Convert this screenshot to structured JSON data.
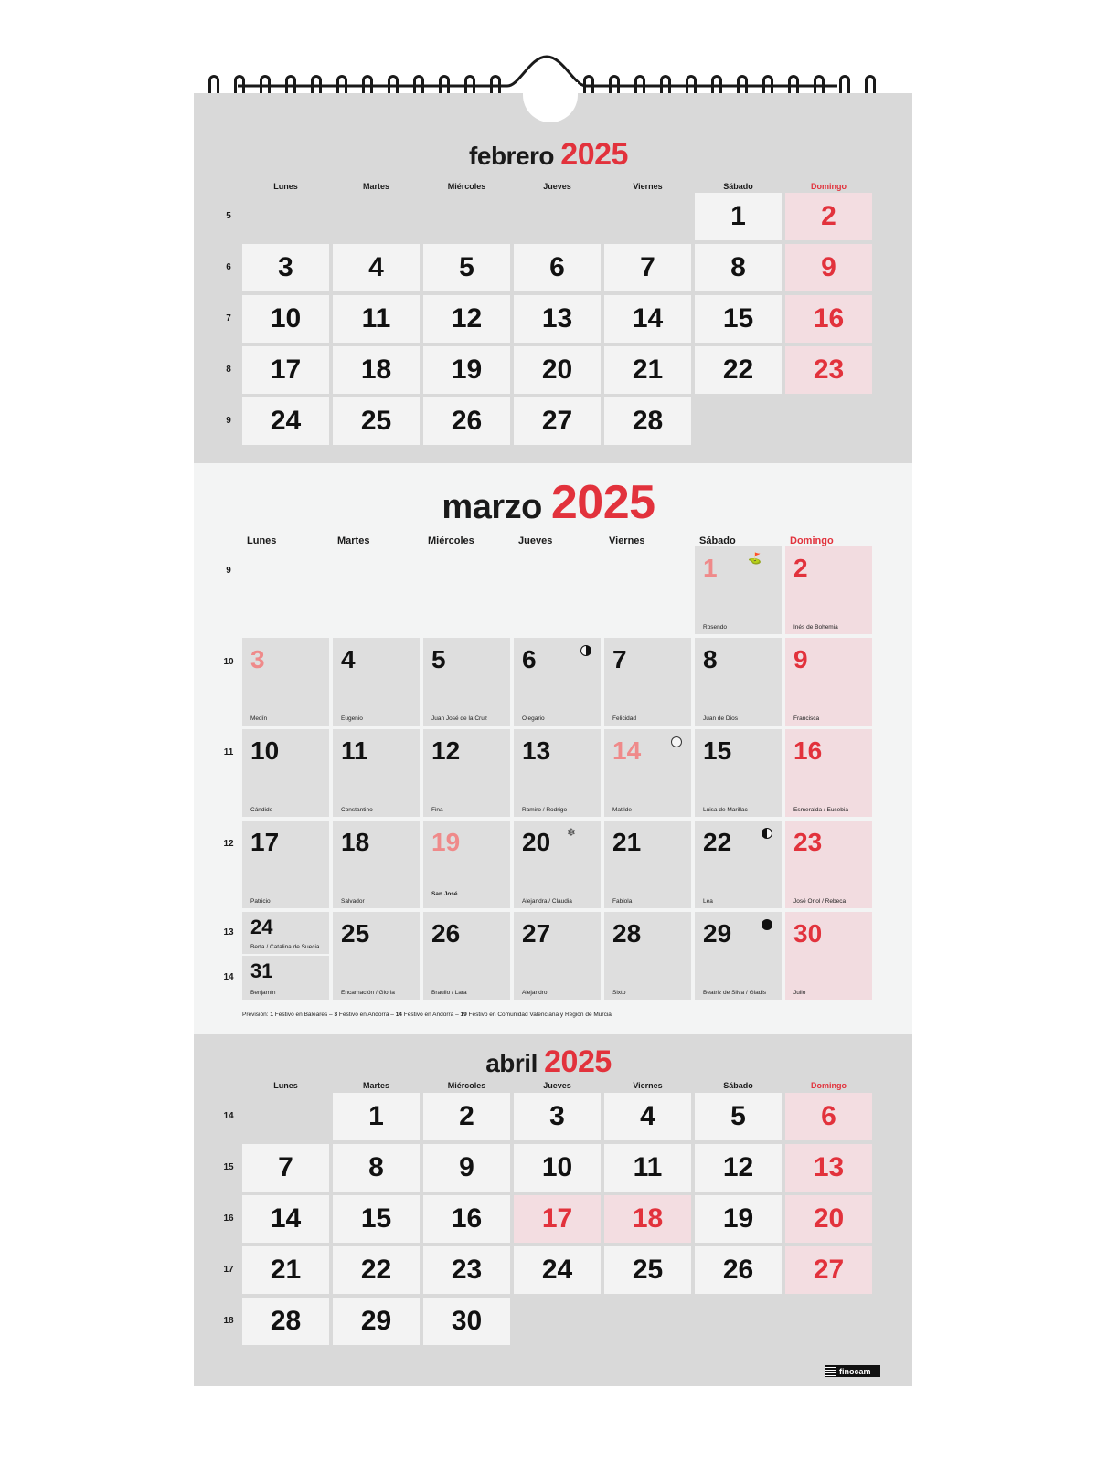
{
  "weekday_labels": [
    "Lunes",
    "Martes",
    "Miércoles",
    "Jueves",
    "Viernes",
    "Sábado",
    "Domingo"
  ],
  "colors": {
    "accent_red": "#e2323c",
    "holiday_pink": "#f3dde1",
    "panel_grey": "#d9d9d9",
    "light_panel": "#f3f4f4"
  },
  "february": {
    "name": "febrero",
    "year": "2025",
    "week_numbers": [
      "5",
      "6",
      "7",
      "8",
      "9"
    ],
    "first_weekday_index": 5,
    "days": 28,
    "holidays": []
  },
  "march": {
    "name": "marzo",
    "year": "2025",
    "week_numbers": [
      "9",
      "10",
      "11",
      "12",
      "13",
      "14"
    ],
    "days": [
      {
        "d": "1",
        "saint": "Rosendo",
        "festivo": true,
        "symbol": "flag-icon"
      },
      {
        "d": "2",
        "saint": "Inés de Bohemia"
      },
      {
        "d": "3",
        "saint": "Medín",
        "festivo": true
      },
      {
        "d": "4",
        "saint": "Eugenio"
      },
      {
        "d": "5",
        "saint": "Juan José de la Cruz"
      },
      {
        "d": "6",
        "saint": "Olegario",
        "moon": "first-quarter-moon-icon"
      },
      {
        "d": "7",
        "saint": "Felicidad"
      },
      {
        "d": "8",
        "saint": "Juan de Dios"
      },
      {
        "d": "9",
        "saint": "Francisca"
      },
      {
        "d": "10",
        "saint": "Cándido"
      },
      {
        "d": "11",
        "saint": "Constantino"
      },
      {
        "d": "12",
        "saint": "Fina"
      },
      {
        "d": "13",
        "saint": "Ramiro / Rodrigo"
      },
      {
        "d": "14",
        "saint": "Matilde",
        "festivo": true,
        "moon": "full-moon-icon"
      },
      {
        "d": "15",
        "saint": "Luisa de Marillac"
      },
      {
        "d": "16",
        "saint": "Esmeralda / Eusebia"
      },
      {
        "d": "17",
        "saint": "Patricio"
      },
      {
        "d": "18",
        "saint": "Salvador"
      },
      {
        "d": "19",
        "saint": "San José",
        "festivo": true,
        "saint_bold": true
      },
      {
        "d": "20",
        "saint": "Alejandra / Claudia",
        "symbol": "spring-snowflake-icon"
      },
      {
        "d": "21",
        "saint": "Fabiola"
      },
      {
        "d": "22",
        "saint": "Lea",
        "moon": "last-quarter-moon-icon"
      },
      {
        "d": "23",
        "saint": "José Oriol / Rebeca"
      },
      {
        "d": "24",
        "saint": "Berta / Catalina de Suecia"
      },
      {
        "d": "25",
        "saint": "Encarnación / Gloria"
      },
      {
        "d": "26",
        "saint": "Braulio / Lara"
      },
      {
        "d": "27",
        "saint": "Alejandro"
      },
      {
        "d": "28",
        "saint": "Sixto"
      },
      {
        "d": "29",
        "saint": "Beatriz de Silva / Gladis",
        "moon": "new-moon-icon"
      },
      {
        "d": "30",
        "saint": "Julio"
      },
      {
        "d": "31",
        "saint": "Benjamín"
      }
    ],
    "footnote_prefix": "Previsión: ",
    "footnote": [
      {
        "b": "1",
        "t": " Festivo en Baleares – "
      },
      {
        "b": "3",
        "t": " Festivo en Andorra – "
      },
      {
        "b": "14",
        "t": " Festivo en Andorra – "
      },
      {
        "b": "19",
        "t": " Festivo en Comunidad Valenciana y Región de Murcia"
      }
    ]
  },
  "april": {
    "name": "abril",
    "year": "2025",
    "week_numbers": [
      "14",
      "15",
      "16",
      "17",
      "18"
    ],
    "first_weekday_index": 1,
    "days": 30,
    "holidays": [
      17,
      18
    ]
  },
  "brand": "finocam"
}
